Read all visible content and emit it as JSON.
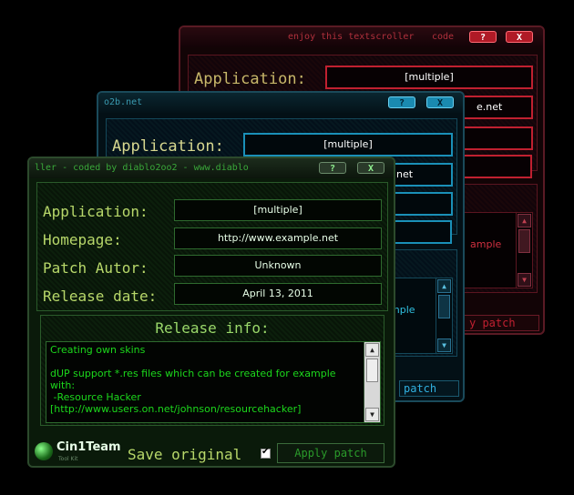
{
  "red_window": {
    "title": "enjoy this textscroller",
    "title_right": "code",
    "app_label": "Application:",
    "app_value": "[multiple]",
    "url_fragment": "e.net",
    "memo_fragment": "ample",
    "patch_fragment": "y patch"
  },
  "blue_window": {
    "title": "o2b.net",
    "help_label": "?",
    "close_label": "X",
    "app_label": "Application:",
    "app_value": "[multiple]",
    "url_fragment": "net",
    "memo_fragment": "mple",
    "patch_fragment": "patch"
  },
  "green_window": {
    "title": "ller  -  coded by diablo2oo2  -  www.diablo",
    "help_label": "?",
    "close_label": "X",
    "fields": [
      {
        "label": "Application:",
        "value": "[multiple]"
      },
      {
        "label": "Homepage:",
        "value": "http://www.example.net"
      },
      {
        "label": "Patch Autor:",
        "value": "Unknown"
      },
      {
        "label": "Release date:",
        "value": "April 13, 2011"
      }
    ],
    "release_info_title": "Release info:",
    "release_info_text": "Creating own skins\n\ndUP support *.res files which can be created for example with:\n -Resource Hacker\n[http://www.users.on.net/johnson/resourcehacker]",
    "logo_text": "Cin1Team",
    "logo_subtext": "Tool Kit",
    "save_original_label": "Save original",
    "save_original_checked": true,
    "apply_patch_label": "Apply patch"
  }
}
